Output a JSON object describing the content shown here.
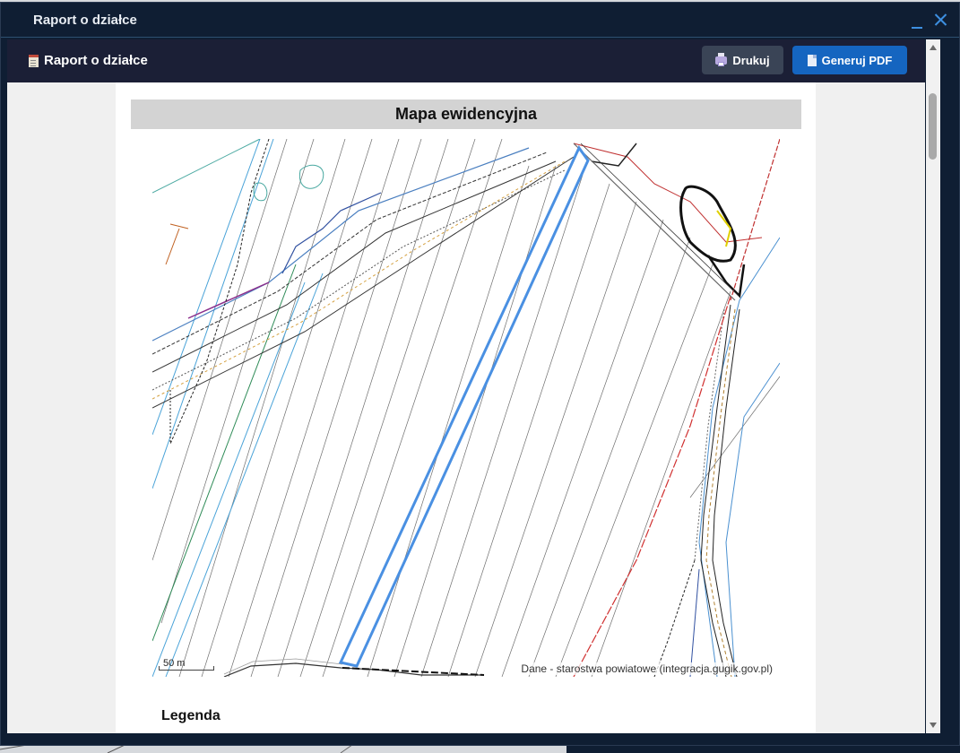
{
  "window": {
    "title": "Raport o działce",
    "minimize_icon": "minimize-icon",
    "close_icon": "close-icon"
  },
  "toolbar": {
    "title": "Raport o działce",
    "title_icon": "report-document-icon",
    "print_label": "Drukuj",
    "print_icon": "printer-icon",
    "pdf_label": "Generuj PDF",
    "pdf_icon": "pdf-document-icon"
  },
  "report": {
    "section_title": "Mapa ewidencyjna",
    "scale_label": "50 m",
    "attribution": "Dane - starostwa powiatowe (integracja.gugik.gov.pl)",
    "legend_title": "Legenda"
  },
  "colors": {
    "window_bg": "#0f1e33",
    "toolbar_bg": "#1b1f36",
    "accent": "#3d8fe0",
    "print_button": "#3a4456",
    "pdf_button": "#1565c0",
    "parcel_highlight": "#4a90e2"
  }
}
